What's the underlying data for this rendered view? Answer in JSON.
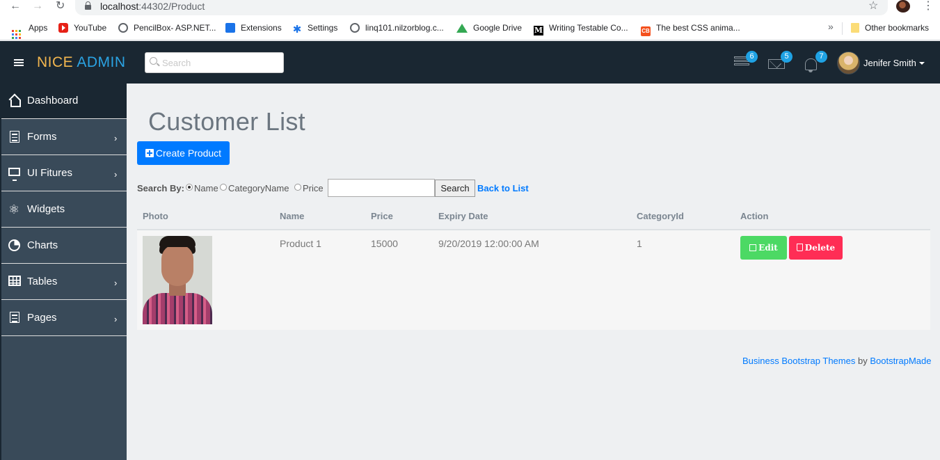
{
  "browser": {
    "url_host": "localhost",
    "url_port_path": ":44302/Product",
    "bookmarks": [
      {
        "label": "Apps",
        "icon": "apps-grid-icon"
      },
      {
        "label": "YouTube",
        "icon": "youtube-icon"
      },
      {
        "label": "PencilBox- ASP.NET...",
        "icon": "globe-icon"
      },
      {
        "label": "Extensions",
        "icon": "puzzle-icon"
      },
      {
        "label": "Settings",
        "icon": "gear-icon"
      },
      {
        "label": "linq101.nilzorblog.c...",
        "icon": "globe-icon"
      },
      {
        "label": "Google Drive",
        "icon": "google-drive-icon"
      },
      {
        "label": "Writing Testable Co...",
        "icon": "medium-icon"
      },
      {
        "label": "The best CSS anima...",
        "icon": "css-icon"
      }
    ],
    "more": "»",
    "other_bookmarks": "Other bookmarks"
  },
  "header": {
    "brand_part1": "NICE",
    "brand_part2": "ADMIN",
    "search_placeholder": "Search",
    "badges": {
      "tasks": "6",
      "mail": "5",
      "notifications": "7"
    },
    "user_name": "Jenifer Smith"
  },
  "sidebar": {
    "items": [
      {
        "label": "Dashboard",
        "icon": "home-icon",
        "active": true,
        "has_submenu": false
      },
      {
        "label": "Forms",
        "icon": "document-icon",
        "has_submenu": true
      },
      {
        "label": "UI Fitures",
        "icon": "monitor-icon",
        "has_submenu": true
      },
      {
        "label": "Widgets",
        "icon": "atom-icon",
        "has_submenu": false
      },
      {
        "label": "Charts",
        "icon": "pie-chart-icon",
        "has_submenu": false
      },
      {
        "label": "Tables",
        "icon": "table-icon",
        "has_submenu": true
      },
      {
        "label": "Pages",
        "icon": "pages-icon",
        "has_submenu": true
      }
    ]
  },
  "main": {
    "title": "Customer List",
    "create_button": "Create Product",
    "search": {
      "label": "Search By:",
      "options": [
        "Name",
        "CategoryName",
        "Price"
      ],
      "selected": "Name",
      "value": "",
      "button": "Search",
      "back_link": "Back to List"
    },
    "table": {
      "columns": [
        "Photo",
        "Name",
        "Price",
        "Expiry Date",
        "CategoryId",
        "Action"
      ],
      "rows": [
        {
          "name": "Product 1",
          "price": "15000",
          "expiry": "9/20/2019 12:00:00 AM",
          "category_id": "1",
          "edit": "Edit",
          "delete": "Delete"
        }
      ]
    }
  },
  "footer": {
    "link1": "Business Bootstrap Themes",
    "by": "by",
    "link2": "BootstrapMade"
  },
  "colors": {
    "topbar": "#1a2732",
    "sidebar": "#394a59",
    "primary": "#007aff",
    "edit": "#4cd964",
    "delete": "#ff2d55",
    "badge": "#1fa2e4",
    "brand_accent": "#f2b64f"
  }
}
